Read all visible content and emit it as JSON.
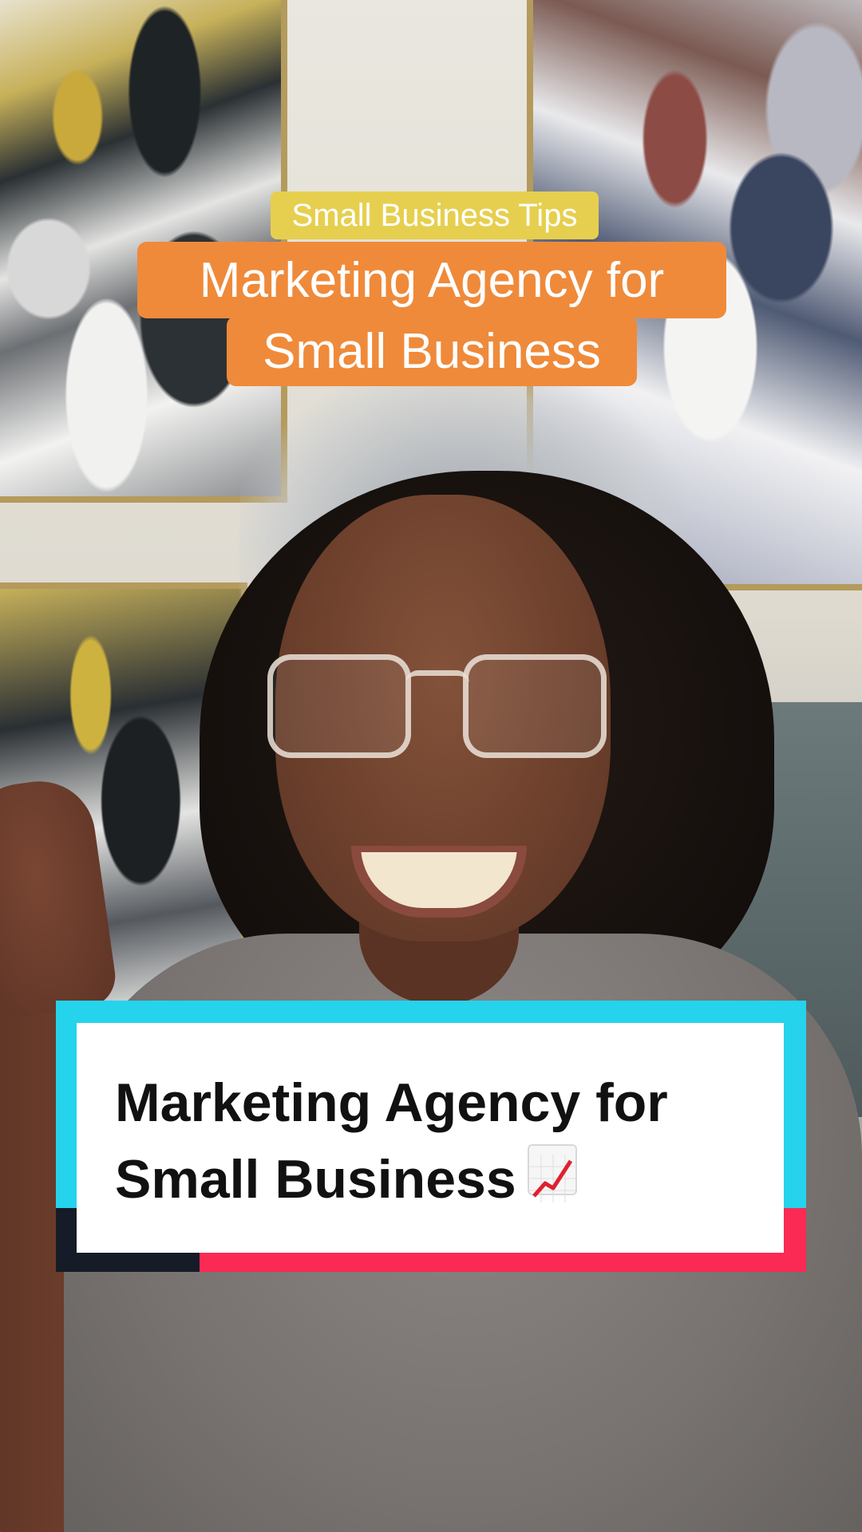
{
  "overlay": {
    "tag_label": "Small Business Tips",
    "headline_line1": "Marketing Agency for",
    "headline_line2": "Small Business",
    "colors": {
      "tag": "#e6cf4e",
      "headline_bg": "#ef8a3a"
    }
  },
  "caption_card": {
    "line1": "Marketing Agency for",
    "line2": "Small Business",
    "emoji_icon": "chart-increasing-icon",
    "colors": {
      "accent_cyan": "#25d3ed",
      "accent_pink": "#fa2a55",
      "accent_dark": "#161b28"
    }
  }
}
